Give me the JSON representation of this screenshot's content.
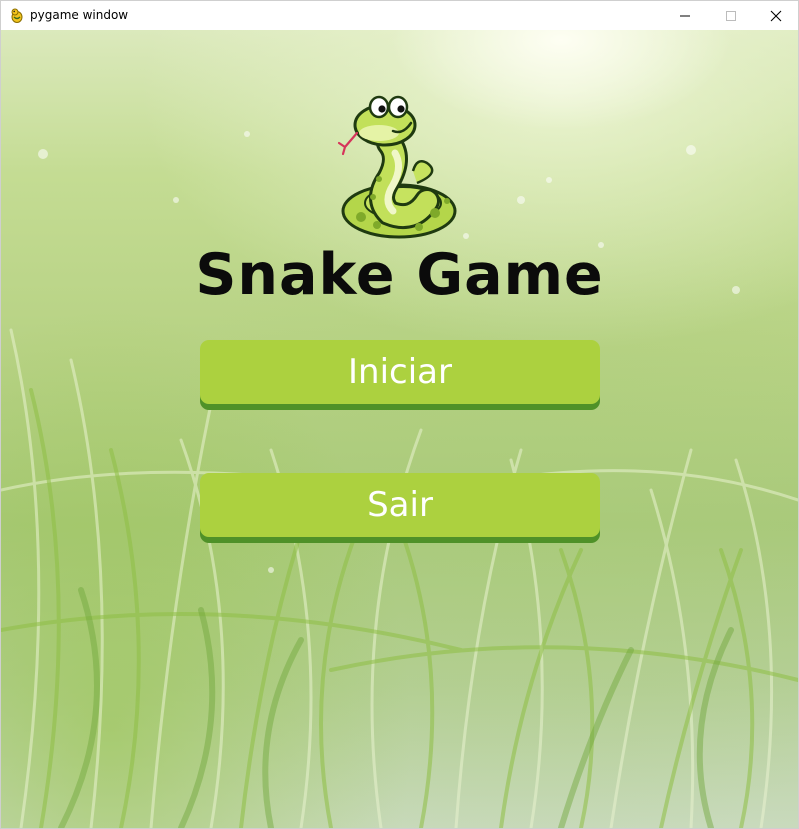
{
  "window": {
    "title": "pygame window",
    "icons": {
      "app": "pygame-snake-icon",
      "minimize": "minimize-icon",
      "maximize": "maximize-icon",
      "close": "close-icon"
    }
  },
  "menu": {
    "logo_icon": "snake-logo-icon",
    "title": "Snake Game",
    "buttons": [
      {
        "label": "Iniciar"
      },
      {
        "label": "Sair"
      }
    ]
  },
  "colors": {
    "button_fill": "#acd13f",
    "button_shadow": "#4f9128",
    "button_text": "#ffffff",
    "title_text": "#0b0b0b",
    "background": "#b7d284"
  }
}
